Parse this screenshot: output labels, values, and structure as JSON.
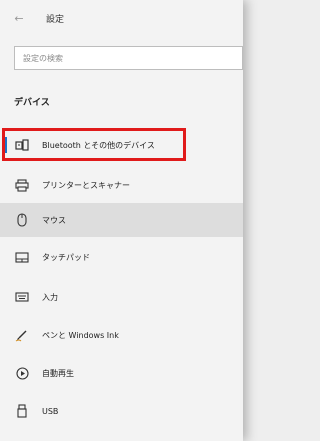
{
  "window": {
    "title": "設定",
    "back_glyph": "←"
  },
  "search": {
    "placeholder": "設定の検索"
  },
  "section": {
    "title": "デバイス"
  },
  "nav": [
    {
      "id": "bluetooth",
      "label": "Bluetooth とその他のデバイス",
      "icon": "bluetooth-devices-icon",
      "selected": true
    },
    {
      "id": "printers",
      "label": "プリンターとスキャナー",
      "icon": "printer-icon"
    },
    {
      "id": "mouse",
      "label": "マウス",
      "icon": "mouse-icon",
      "hovered": true
    },
    {
      "id": "touchpad",
      "label": "タッチパッド",
      "icon": "touchpad-icon"
    },
    {
      "id": "input",
      "label": "入力",
      "icon": "keyboard-icon"
    },
    {
      "id": "pen",
      "label": "ペンと Windows Ink",
      "icon": "pen-icon"
    },
    {
      "id": "autoplay",
      "label": "自動再生",
      "icon": "autoplay-icon"
    },
    {
      "id": "usb",
      "label": "USB",
      "icon": "usb-icon"
    }
  ],
  "colors": {
    "accent": "#1a73c7",
    "highlight_border": "#e01a1a",
    "hover_bg": "#dddddd",
    "window_bg": "#f3f3f3"
  }
}
